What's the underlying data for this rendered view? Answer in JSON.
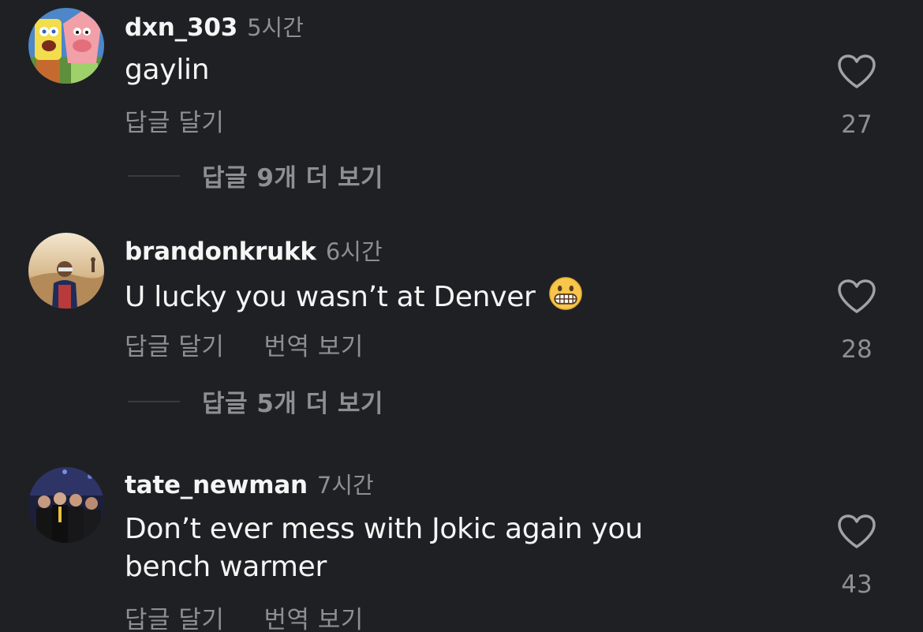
{
  "comments": [
    {
      "username": "dxn_303",
      "time": "5시간",
      "text": "gaylin",
      "text_line2": "",
      "reply_label": "답글 달기",
      "translate_label": "",
      "view_replies": "답글 9개 더 보기",
      "likes": "27",
      "avatar_icon": "spongebob-patrick-avatar"
    },
    {
      "username": "brandonkrukk",
      "time": "6시간",
      "text": "U lucky you wasn’t at Denver",
      "text_line2": "",
      "emoji": "grimacing-face",
      "reply_label": "답글 달기",
      "translate_label": "번역 보기",
      "view_replies": "답글 5개 더 보기",
      "likes": "28",
      "avatar_icon": "desert-person-avatar"
    },
    {
      "username": "tate_newman",
      "time": "7시간",
      "text": "Don’t ever mess with Jokic again you",
      "text_line2": "bench warmer",
      "reply_label": "답글 달기",
      "translate_label": "번역 보기",
      "view_replies": "",
      "likes": "43",
      "avatar_icon": "group-photo-avatar"
    }
  ],
  "colors": {
    "background": "#1f2023",
    "primary_text": "#f5f5f5",
    "secondary_text": "#8e8e93",
    "divider": "#3a3b40"
  }
}
